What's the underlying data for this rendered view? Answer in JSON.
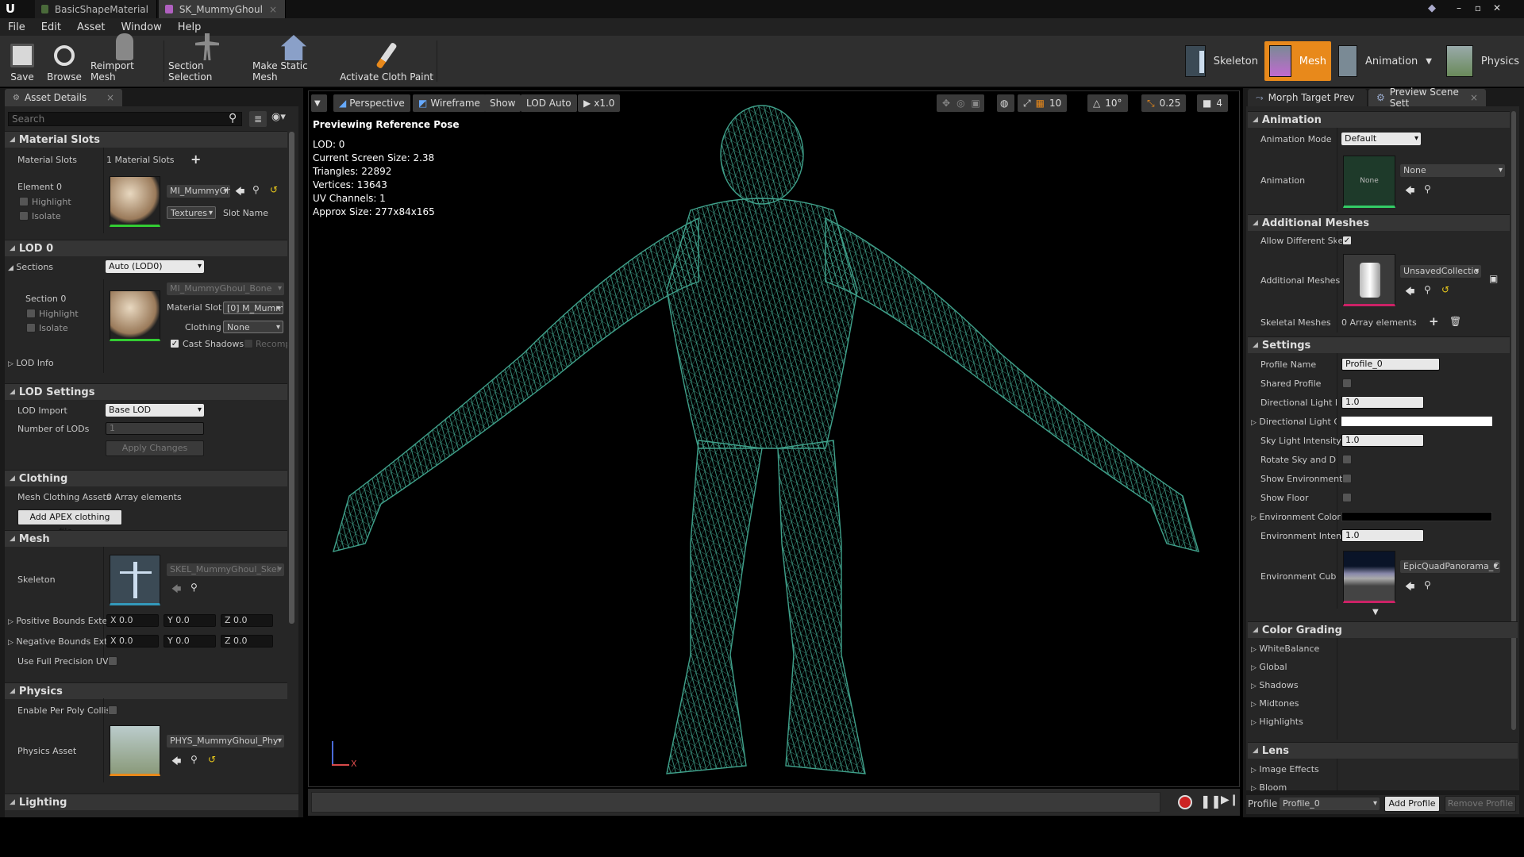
{
  "titlebar": {
    "tabs": [
      "BasicShapeMaterial",
      "SK_MummyGhoul"
    ]
  },
  "menu": [
    "File",
    "Edit",
    "Asset",
    "Window",
    "Help"
  ],
  "toolbar": {
    "buttons": [
      "Save",
      "Browse",
      "Reimport Mesh",
      "Section Selection",
      "Make Static Mesh",
      "Activate Cloth Paint"
    ],
    "modes": [
      "Skeleton",
      "Mesh",
      "Animation",
      "Physics"
    ]
  },
  "left": {
    "tab": "Asset Details",
    "search_placeholder": "Search",
    "material_slots": {
      "cat": "Material Slots",
      "label": "Material Slots",
      "count": "1 Material Slots",
      "element": "Element 0",
      "highlight": "Highlight",
      "isolate": "Isolate",
      "material": "MI_MummyGhoul",
      "textures": "Textures",
      "slot_name": "Slot Name"
    },
    "lod0": {
      "cat": "LOD 0",
      "sections": "Sections",
      "sections_value": "Auto (LOD0)",
      "section": "Section 0",
      "highlight": "Highlight",
      "isolate": "Isolate",
      "material": "MI_MummyGhoul_Bone",
      "material_slot_label": "Material Slot",
      "material_slot_value": "[0] M_Mumm",
      "clothing_label": "Clothing",
      "clothing_value": "None",
      "cast_shadows": "Cast Shadows",
      "recompute": "Recompu",
      "lod_info": "LOD Info"
    },
    "lod_settings": {
      "cat": "LOD Settings",
      "lod_import": "LOD Import",
      "lod_import_value": "Base LOD",
      "num_lods": "Number of LODs",
      "num_lods_value": "1",
      "apply": "Apply Changes"
    },
    "clothing": {
      "cat": "Clothing",
      "label": "Mesh Clothing Assets",
      "value": "0 Array elements",
      "add": "Add APEX clothing file..."
    },
    "mesh": {
      "cat": "Mesh",
      "skeleton": "Skeleton",
      "skeleton_value": "SKEL_MummyGhoul_Skel",
      "pos_bounds": "Positive Bounds Exte",
      "neg_bounds": "Negative Bounds Ext",
      "x": "X",
      "y": "Y",
      "z": "Z",
      "zero": "0.0",
      "full_uv": "Use Full Precision UV"
    },
    "physics": {
      "cat": "Physics",
      "per_poly": "Enable Per Poly Collis",
      "asset": "Physics Asset",
      "asset_value": "PHYS_MummyGhoul_Phy"
    },
    "lighting": {
      "cat": "Lighting"
    }
  },
  "viewport": {
    "toolbar": {
      "perspective": "Perspective",
      "wireframe": "Wireframe",
      "show": "Show",
      "lod": "LOD Auto",
      "speed": "x1.0",
      "grid": "10",
      "angle": "10°",
      "scale": "0.25",
      "cam": "4"
    },
    "heading": "Previewing Reference Pose",
    "stats": [
      "LOD: 0",
      "Current Screen Size: 2.38",
      "Triangles: 22892",
      "Vertices: 13643",
      "UV Channels: 1",
      "Approx Size: 277x84x165"
    ],
    "axis_x": "X"
  },
  "right": {
    "tabs": [
      "Morph Target Prev",
      "Preview Scene Sett"
    ],
    "animation": {
      "cat": "Animation",
      "mode_label": "Animation Mode",
      "mode_value": "Default",
      "anim_label": "Animation",
      "anim_thumb": "None",
      "anim_value": "None"
    },
    "additional": {
      "cat": "Additional Meshes",
      "allow": "Allow Different Ske",
      "meshes": "Additional Meshes",
      "meshes_value": "UnsavedCollectio",
      "skeletal": "Skeletal Meshes",
      "skeletal_value": "0 Array elements"
    },
    "settings": {
      "cat": "Settings",
      "rows": [
        {
          "label": "Profile Name",
          "value": "Profile_0"
        },
        {
          "label": "Shared Profile"
        },
        {
          "label": "Directional Light Int",
          "value": "1.0"
        },
        {
          "label": "Directional Light Co"
        },
        {
          "label": "Sky Light Intensity",
          "value": "1.0"
        },
        {
          "label": "Rotate Sky and Dire"
        },
        {
          "label": "Show Environment"
        },
        {
          "label": "Show Floor"
        },
        {
          "label": "Environment Color"
        },
        {
          "label": "Environment Intens",
          "value": "1.0"
        },
        {
          "label": "Environment Cube M",
          "value": "EpicQuadPanorama_C"
        }
      ]
    },
    "color_grading": {
      "cat": "Color Grading",
      "items": [
        "WhiteBalance",
        "Global",
        "Shadows",
        "Midtones",
        "Highlights"
      ]
    },
    "lens": {
      "cat": "Lens",
      "items": [
        "Image Effects",
        "Bloom"
      ]
    },
    "footer": {
      "profile_label": "Profile",
      "profile_value": "Profile_0",
      "add": "Add Profile",
      "remove": "Remove Profile"
    }
  },
  "colors": {
    "accent": "#e8891b",
    "wire": "#3fa08a",
    "panel": "#262626",
    "header": "#353535"
  }
}
